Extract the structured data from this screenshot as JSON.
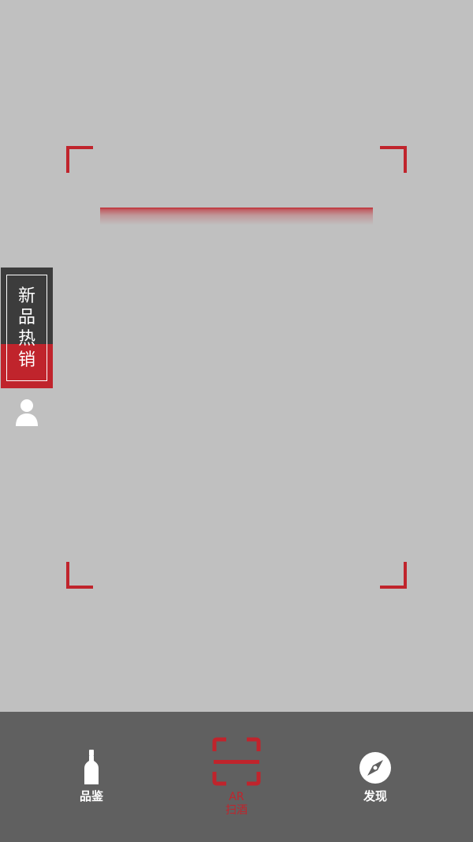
{
  "side_promo": {
    "label": "新品热销"
  },
  "tabbar": {
    "tabs": [
      {
        "label": "品鉴",
        "icon": "bottle-icon"
      },
      {
        "label_line1": "AR",
        "label_line2": "扫酒",
        "icon": "scan-icon"
      },
      {
        "label": "发现",
        "icon": "compass-icon"
      }
    ]
  },
  "colors": {
    "accent": "#c0242c",
    "viewfinder_bg": "#c0c0c0",
    "tabbar_bg": "#606060",
    "promo_dark": "#3c3c3c",
    "icon_white": "#ffffff"
  }
}
